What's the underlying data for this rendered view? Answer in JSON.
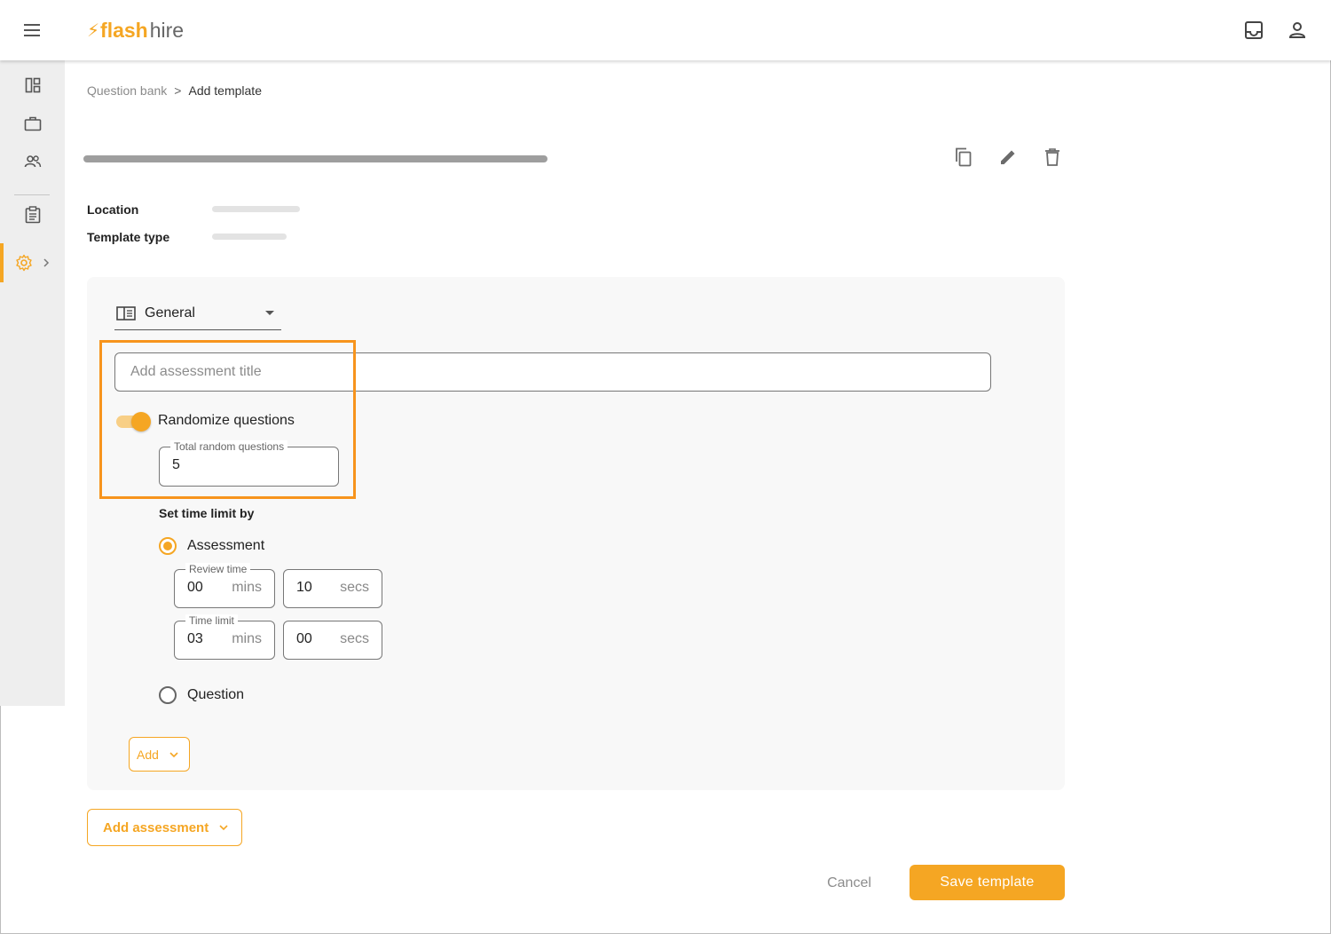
{
  "app": {
    "logo_flash": "flash",
    "logo_hire": "hire",
    "brand_color": "#f5a623"
  },
  "topbar": {
    "menu_icon": "hamburger-menu-icon",
    "icons": [
      "inbox-icon",
      "user-account-icon"
    ]
  },
  "sidebar": {
    "items": [
      {
        "icon": "dashboard-icon"
      },
      {
        "icon": "briefcase-icon"
      },
      {
        "icon": "people-icon"
      },
      {
        "icon": "clipboard-icon"
      },
      {
        "icon": "settings-gear-icon",
        "active": true
      }
    ]
  },
  "breadcrumb": {
    "parent": "Question bank",
    "separator": ">",
    "current": "Add template"
  },
  "header_actions": [
    "copy-icon",
    "edit-pencil-icon",
    "delete-trash-icon"
  ],
  "meta": {
    "location_label": "Location",
    "template_type_label": "Template type"
  },
  "form": {
    "section_select": {
      "value": "General"
    },
    "assessment_title": {
      "placeholder": "Add assessment title",
      "value": ""
    },
    "randomize": {
      "label": "Randomize questions",
      "enabled": true
    },
    "total_random_questions": {
      "label": "Total random questions",
      "value": "5"
    },
    "time_limit_section_label": "Set time limit by",
    "options": {
      "assessment_label": "Assessment",
      "question_label": "Question",
      "selected": "Assessment"
    },
    "review_time": {
      "label": "Review time",
      "mins": "00",
      "mins_unit": "mins",
      "secs": "10",
      "secs_unit": "secs"
    },
    "time_limit": {
      "label": "Time limit",
      "mins": "03",
      "mins_unit": "mins",
      "secs": "00",
      "secs_unit": "secs"
    },
    "add_button": "Add"
  },
  "footer": {
    "add_assessment": "Add assessment",
    "cancel": "Cancel",
    "save": "Save template"
  }
}
